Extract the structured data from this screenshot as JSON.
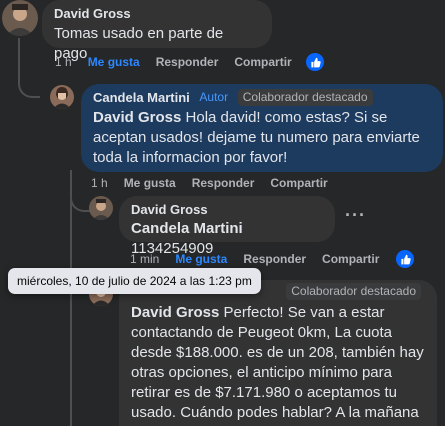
{
  "comment1": {
    "author": "David Gross",
    "text": "Tomas usado en parte de pago",
    "time": "1 h",
    "like_label": "Me gusta",
    "reply_label": "Responder",
    "share_label": "Compartir"
  },
  "reply1": {
    "author": "Candela Martini",
    "author_badge": "Autor",
    "featured_badge": "Colaborador destacado",
    "mention": "David Gross",
    "text": " Hola david! como estas? Si se aceptan usados! dejame tu numero para enviarte toda la informacion por favor!",
    "time": "1 h",
    "like_label": "Me gusta",
    "reply_label": "Responder",
    "share_label": "Compartir"
  },
  "reply2": {
    "author": "David Gross",
    "mention": "Candela Martini",
    "text": " 1134254909",
    "time": "1 min",
    "like_label": "Me gusta",
    "reply_label": "Responder",
    "share_label": "Compartir"
  },
  "reply3": {
    "featured_badge": "Colaborador destacado",
    "mention": "David Gross",
    "text": " Perfecto! Se van a estar contactando de Peugeot 0km, La cuota desde $188.000. es de un 208, también hay otras opciones, el anticipo mínimo para retirar es de $7.171.980 o aceptamos tu usado. Cuándo podes hablar? A la mañana o a la tarde?"
  },
  "tooltip": "miércoles, 10 de julio de 2024 a las 1:23 pm",
  "colors": {
    "background": "#252728",
    "bubble": "#333334",
    "bubble_highlight": "#1d3a5f",
    "accent": "#2d88ff"
  }
}
